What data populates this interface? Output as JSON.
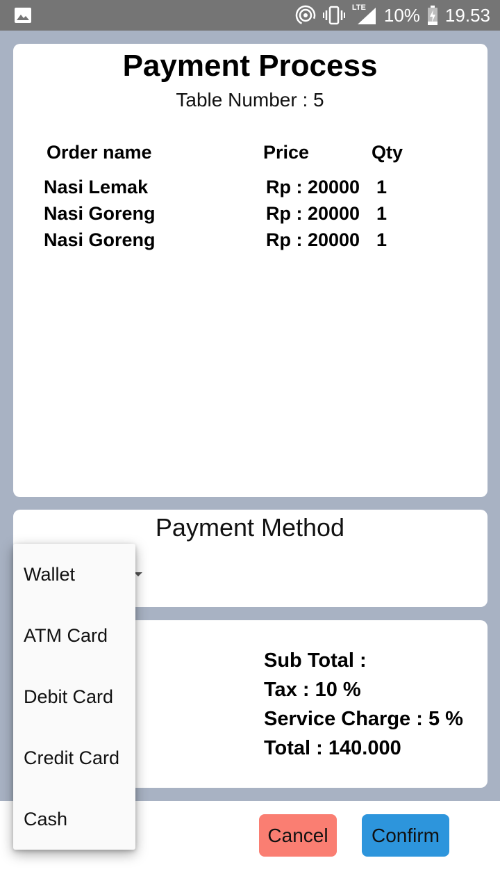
{
  "status_bar": {
    "battery": "10%",
    "time": "19.53",
    "network": "LTE",
    "icons": [
      "image-icon",
      "hotspot-icon",
      "vibrate-icon",
      "signal-icon",
      "battery-charging-icon"
    ]
  },
  "order": {
    "title": "Payment Process",
    "table_number": "Table Number : 5",
    "columns": {
      "name": "Order name",
      "price": "Price",
      "qty": "Qty"
    },
    "items": [
      {
        "name": "Nasi Lemak",
        "price": "Rp : 20000",
        "qty": "1"
      },
      {
        "name": "Nasi Goreng",
        "price": "Rp : 20000",
        "qty": "1"
      },
      {
        "name": "Nasi Goreng",
        "price": "Rp : 20000",
        "qty": "1"
      }
    ]
  },
  "payment_method": {
    "title": "Payment Method",
    "options": [
      "Wallet",
      "ATM Card",
      "Debit Card",
      "Credit Card",
      "Cash"
    ]
  },
  "summary": {
    "sub_total": "Sub Total :",
    "tax": "Tax : 10 %",
    "service_charge": "Service Charge : 5 %",
    "total": "Total : 140.000"
  },
  "actions": {
    "cancel": "Cancel",
    "confirm": "Confirm"
  },
  "colors": {
    "background": "#a8b2c3",
    "status_bar": "#757575",
    "cancel": "#fa7e72",
    "confirm": "#2d95dc"
  }
}
